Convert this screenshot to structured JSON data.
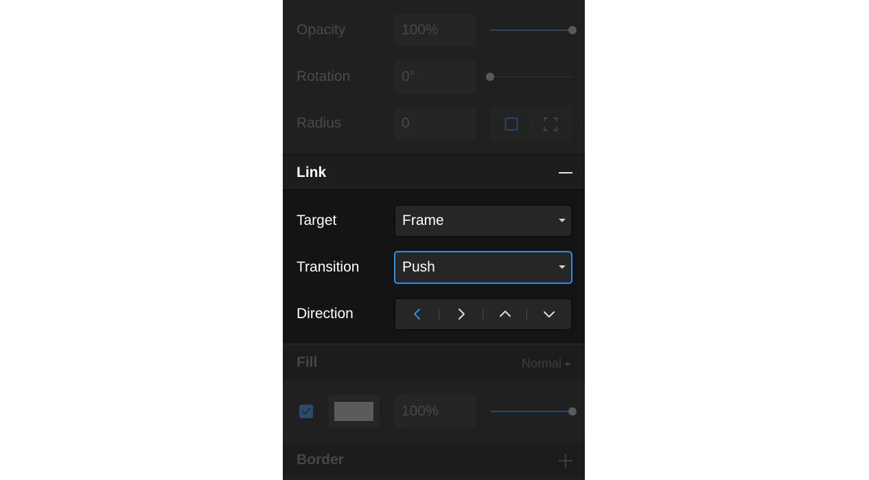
{
  "properties": {
    "opacity": {
      "label": "Opacity",
      "value": "100%",
      "slider_level": 1.0
    },
    "rotation": {
      "label": "Rotation",
      "value": "0°",
      "slider_level": 0.0
    },
    "radius": {
      "label": "Radius",
      "value": "0",
      "icons": [
        "square-corners-icon",
        "individual-corners-icon"
      ]
    }
  },
  "link": {
    "title": "Link",
    "collapse_icon": "minus-icon",
    "target": {
      "label": "Target",
      "value": "Frame"
    },
    "transition": {
      "label": "Transition",
      "value": "Push"
    },
    "direction": {
      "label": "Direction",
      "options": [
        "chevron-left-icon",
        "chevron-right-icon",
        "chevron-up-icon",
        "chevron-down-icon"
      ],
      "selected_index": 0
    }
  },
  "fill": {
    "title": "Fill",
    "blend_mode": "Normal",
    "enabled": true,
    "color": "#5b5b5b",
    "opacity_value": "100%",
    "slider_level": 1.0
  },
  "border": {
    "title": "Border",
    "add_icon": "plus-icon"
  },
  "colors": {
    "accent": "#2d8ff0",
    "panel": "#202020",
    "link_body": "#141414"
  }
}
